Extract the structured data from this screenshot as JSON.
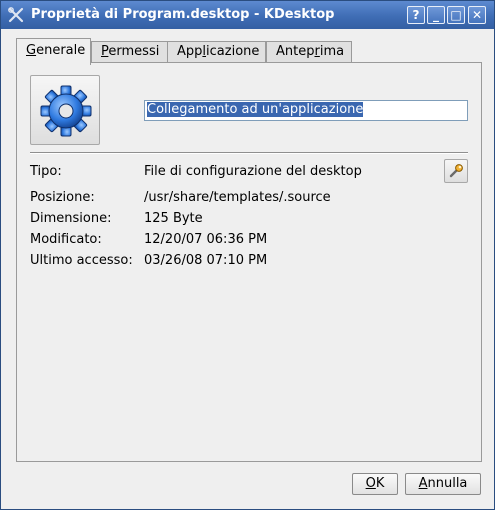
{
  "window": {
    "title": "Proprietà di Program.desktop - KDesktop",
    "buttons": {
      "help": "?",
      "minimize": "_",
      "maximize": "□",
      "close": "✕"
    }
  },
  "tabs": [
    {
      "pre": "",
      "u": "G",
      "post": "enerale"
    },
    {
      "pre": "",
      "u": "P",
      "post": "ermessi"
    },
    {
      "pre": "App",
      "u": "l",
      "post": "icazione"
    },
    {
      "pre": "Antep",
      "u": "r",
      "post": "ima"
    }
  ],
  "general": {
    "name_value": "Collegamento ad un'applicazione",
    "rows": [
      {
        "label": "Tipo:",
        "value": "File di configurazione del desktop"
      },
      {
        "label": "Posizione:",
        "value": "/usr/share/templates/.source"
      },
      {
        "label": "Dimensione:",
        "value": "125 Byte"
      },
      {
        "label": "Modificato:",
        "value": "12/20/07 06:36 PM"
      },
      {
        "label": "Ultimo accesso:",
        "value": "03/26/08 07:10 PM"
      }
    ]
  },
  "dialog": {
    "ok": {
      "u": "O",
      "post": "K"
    },
    "cancel": {
      "u": "A",
      "post": "nnulla"
    }
  },
  "colors": {
    "accent": "#3f6db5",
    "selection": "#3a67b0"
  }
}
